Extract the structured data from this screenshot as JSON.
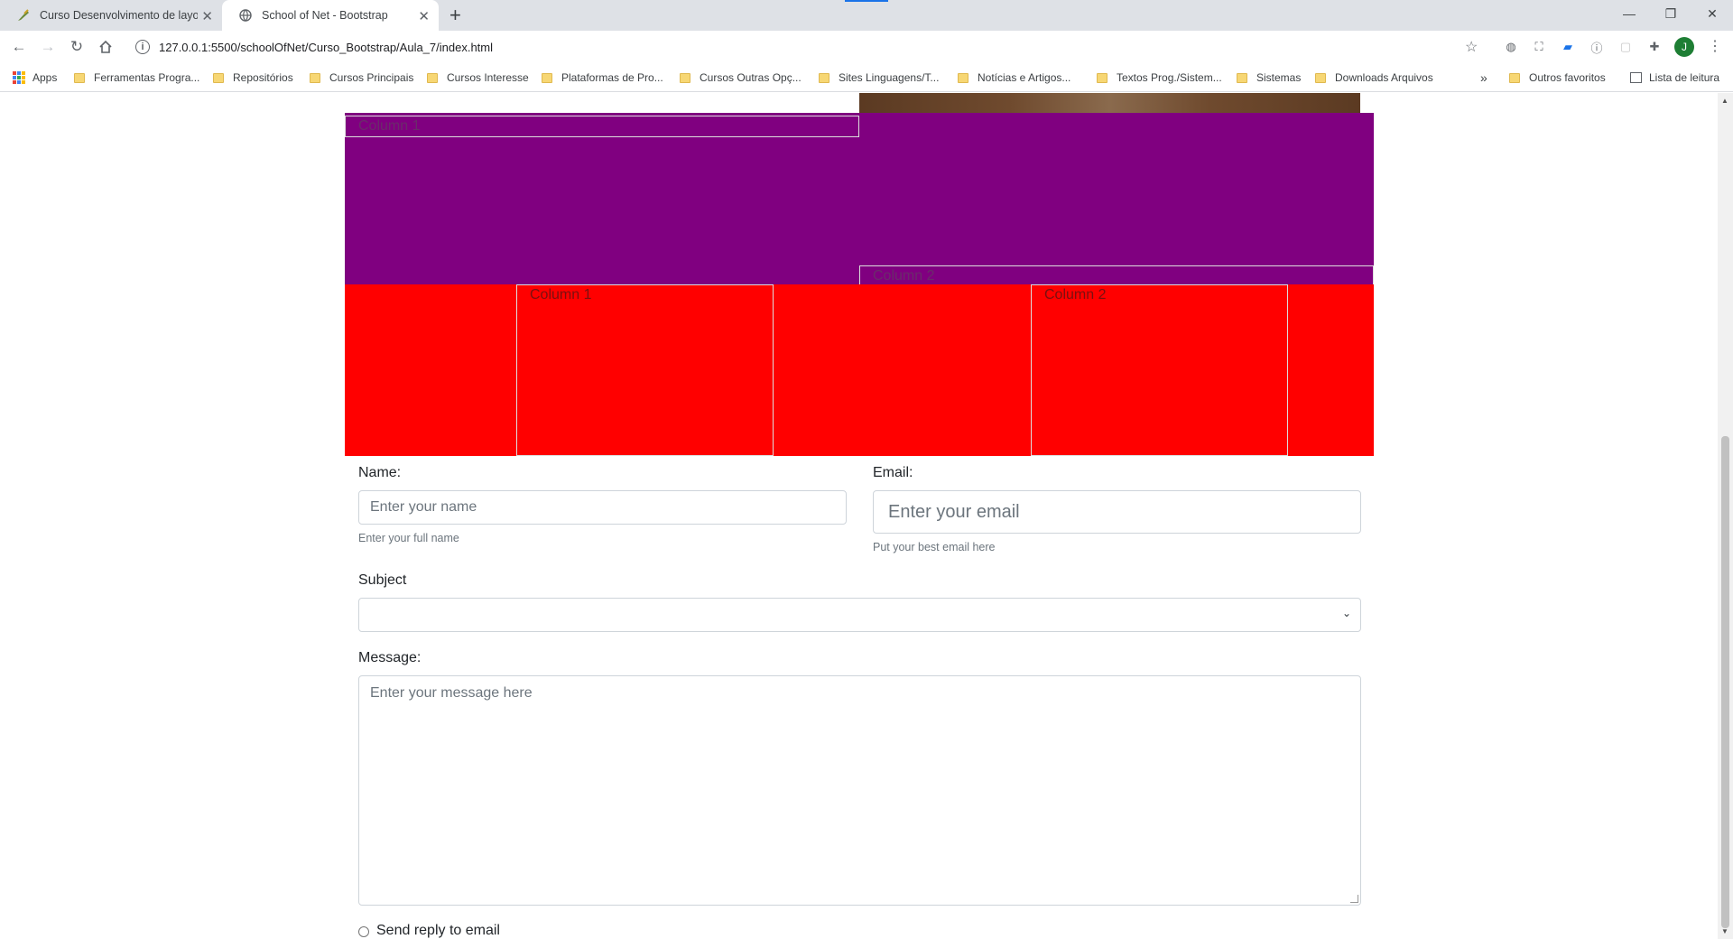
{
  "browser": {
    "tabs": [
      {
        "title": "Curso Desenvolvimento de layou",
        "active": false
      },
      {
        "title": "School of Net - Bootstrap",
        "active": true
      }
    ],
    "new_tab_label": "+",
    "url": "127.0.0.1:5500/schoolOfNet/Curso_Bootstrap/Aula_7/index.html",
    "avatar_letter": "J",
    "bookmarks": [
      "Apps",
      "Ferramentas Progra...",
      "Repositórios",
      "Cursos Principais",
      "Cursos Interesse",
      "Plataformas de Pro...",
      "Cursos Outras Opç...",
      "Sites Linguagens/T...",
      "Notícias e Artigos...",
      "Textos Prog./Sistem...",
      "Sistemas",
      "Downloads Arquivos"
    ],
    "overflow_label": "»",
    "other_bookmarks": "Outros favoritos",
    "reading_list": "Lista de leitura"
  },
  "page": {
    "purple_row": {
      "col1": "Column 1",
      "col2": "Column 2",
      "color": "#800080"
    },
    "red_row": {
      "col1": "Column 1",
      "col2": "Column 2",
      "color": "#ff0000"
    },
    "form": {
      "name_label": "Name:",
      "name_placeholder": "Enter your name",
      "name_help": "Enter your full name",
      "email_label": "Email:",
      "email_placeholder": "Enter your email",
      "email_help": "Put your best email here",
      "subject_label": "Subject",
      "subject_value": "",
      "message_label": "Message:",
      "message_placeholder": "Enter your message here",
      "reply_label": "Send reply to email"
    }
  }
}
